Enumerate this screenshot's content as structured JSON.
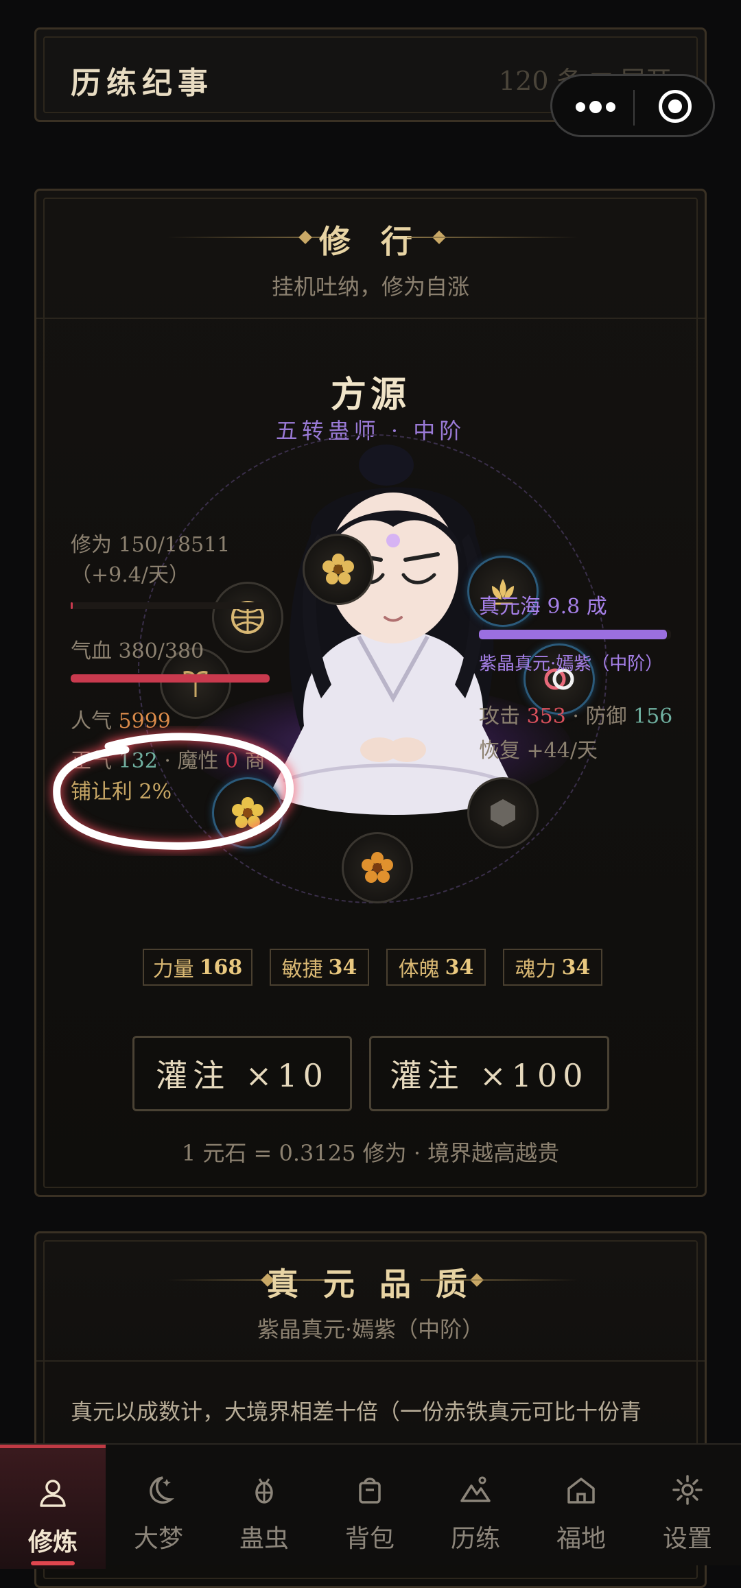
{
  "journal": {
    "title": "历练纪事",
    "count_label": "120 条 ▼ 展开"
  },
  "capsule": {
    "more_icon": "more-dots-icon",
    "close_icon": "target-close-icon"
  },
  "cultivation": {
    "title": "修 行",
    "subtitle": "挂机吐纳，修为自涨",
    "character": {
      "name": "方源",
      "rank": "五转蛊师 · 中阶"
    },
    "stats_left": {
      "cultivation": "修为 150/18511",
      "cultivation_rate": "（+9.4/天）",
      "cultivation_progress": 0.0081,
      "hp": "气血 380/380",
      "hp_progress": 1.0,
      "popularity_label": "人气",
      "popularity_value": "5999",
      "righteous_label": "正气",
      "righteous_value": "132",
      "demonic_label": "魔性",
      "demonic_value": "0",
      "shop_text_1": "商",
      "shop_text_2": "铺让利 2%"
    },
    "stats_right": {
      "essence_sea": "真元海 9.8 成",
      "essence_progress": 0.98,
      "essence_type": "紫晶真元·嫣紫（中阶）",
      "attack_label": "攻击",
      "attack_value": "353",
      "defense_label": "防御",
      "defense_value": "156",
      "recovery": "恢复 +44/天"
    },
    "attributes": [
      {
        "label": "力量",
        "value": "168"
      },
      {
        "label": "敏捷",
        "value": "34"
      },
      {
        "label": "体魄",
        "value": "34"
      },
      {
        "label": "魂力",
        "value": "34"
      }
    ],
    "buttons": {
      "infuse_10": "灌注 ×10",
      "infuse_100": "灌注 ×100"
    },
    "rate_note": "1 元石 = 0.3125 修为 · 境界越高越贵"
  },
  "essence": {
    "title": "真 元 品 质",
    "subtitle": "紫晶真元·嫣紫（中阶）",
    "description": "真元以成数计，大境界相差十倍（一份赤铁真元可比十份青"
  },
  "nav": [
    {
      "label": "修炼",
      "icon": "person-icon",
      "active": true
    },
    {
      "label": "大梦",
      "icon": "moon-icon",
      "active": false
    },
    {
      "label": "蛊虫",
      "icon": "bug-icon",
      "active": false
    },
    {
      "label": "背包",
      "icon": "bag-icon",
      "active": false
    },
    {
      "label": "历练",
      "icon": "mountain-icon",
      "active": false
    },
    {
      "label": "福地",
      "icon": "home-icon",
      "active": false
    },
    {
      "label": "设置",
      "icon": "gear-icon",
      "active": false
    }
  ],
  "colors": {
    "accent_red": "#c03a44",
    "essence_purple": "#9b6fe0",
    "hp_red": "#c93a4e",
    "gold": "#c9a866"
  }
}
